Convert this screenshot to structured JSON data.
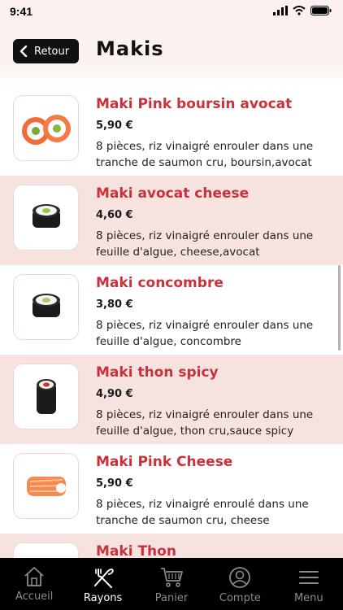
{
  "status_bar": {
    "time": "9:41"
  },
  "header": {
    "back_label": "Retour",
    "title": "Makis"
  },
  "items": [
    {
      "name": "Maki Pink boursin avocat",
      "price": "5,90 €",
      "desc_line1": "8 pièces, riz vinaigré enrouler dans une",
      "desc_line2": "tranche de saumon cru, boursin,avocat",
      "image_icon": "salmon-roll-icon"
    },
    {
      "name": "Maki avocat cheese",
      "price": "4,60 €",
      "desc_line1": "8 pièces, riz vinaigré enrouler dans une",
      "desc_line2": "feuille d'algue, cheese,avocat",
      "image_icon": "nori-roll-icon"
    },
    {
      "name": "Maki concombre",
      "price": "3,80 €",
      "desc_line1": "8 pièces, riz vinaigré enrouler dans une",
      "desc_line2": "feuille d'algue, concombre",
      "image_icon": "nori-roll-icon"
    },
    {
      "name": "Maki thon spicy",
      "price": "4,90 €",
      "desc_line1": "8 pièces, riz vinaigré enrouler dans une",
      "desc_line2": "feuille d'algue, thon cru,sauce spicy",
      "image_icon": "tuna-roll-icon"
    },
    {
      "name": "Maki Pink Cheese",
      "price": "5,90 €",
      "desc_line1": "8 pièces, riz vinaigré enroulé dans une",
      "desc_line2": "tranche de saumon cru, cheese",
      "image_icon": "salmon-roll-icon"
    },
    {
      "name": "Maki Thon",
      "price": "",
      "desc_line1": "",
      "desc_line2": "",
      "image_icon": "tuna-roll-icon"
    }
  ],
  "tabbar": {
    "tabs": [
      {
        "label": "Accueil",
        "icon": "home-icon",
        "active": false
      },
      {
        "label": "Rayons",
        "icon": "fork-knife-icon",
        "active": true
      },
      {
        "label": "Panier",
        "icon": "cart-icon",
        "active": false
      },
      {
        "label": "Compte",
        "icon": "user-icon",
        "active": false
      },
      {
        "label": "Menu",
        "icon": "hamburger-menu-icon",
        "active": false
      }
    ]
  },
  "colors": {
    "accent_red": "#c9313b",
    "alt_row": "#f6e3df",
    "header_bg": "#fbf1ee",
    "tabbar_bg": "#000000"
  }
}
